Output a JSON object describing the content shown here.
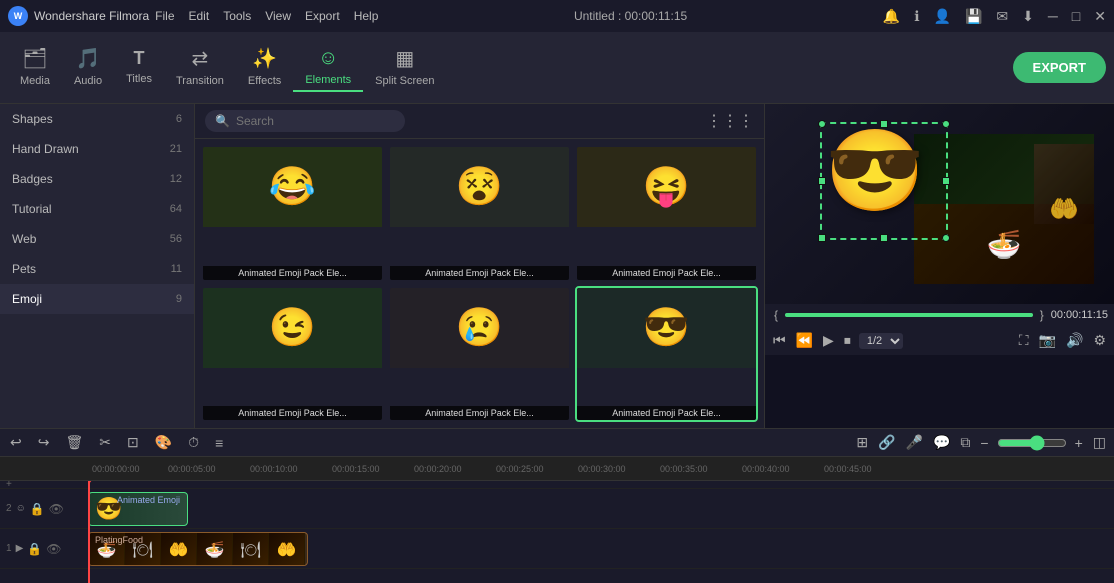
{
  "app": {
    "name": "Wondershare Filmora",
    "logo": "W",
    "title": "Untitled : 00:00:11:15"
  },
  "menu": {
    "items": [
      "File",
      "Edit",
      "Tools",
      "View",
      "Export",
      "Help"
    ]
  },
  "titlebar": {
    "controls": [
      "🔔",
      "ℹ",
      "👤",
      "💾",
      "✉",
      "⬇"
    ]
  },
  "toolbar": {
    "items": [
      {
        "id": "media",
        "label": "Media",
        "icon": "🗂"
      },
      {
        "id": "audio",
        "label": "Audio",
        "icon": "🎵"
      },
      {
        "id": "titles",
        "label": "Titles",
        "icon": "T"
      },
      {
        "id": "transition",
        "label": "Transition",
        "icon": "⇄"
      },
      {
        "id": "effects",
        "label": "Effects",
        "icon": "✨"
      },
      {
        "id": "elements",
        "label": "Elements",
        "icon": "☺"
      },
      {
        "id": "splitscreen",
        "label": "Split Screen",
        "icon": "▦"
      }
    ],
    "active": "elements",
    "export_label": "EXPORT"
  },
  "categories": [
    {
      "id": "shapes",
      "label": "Shapes",
      "count": 6
    },
    {
      "id": "handdrawn",
      "label": "Hand Drawn",
      "count": 21
    },
    {
      "id": "badges",
      "label": "Badges",
      "count": 12
    },
    {
      "id": "tutorial",
      "label": "Tutorial",
      "count": 64
    },
    {
      "id": "web",
      "label": "Web",
      "count": 56
    },
    {
      "id": "pets",
      "label": "Pets",
      "count": 11
    },
    {
      "id": "emoji",
      "label": "Emoji",
      "count": 9
    }
  ],
  "search": {
    "placeholder": "Search",
    "value": ""
  },
  "grid_items": [
    {
      "id": 1,
      "label": "Animated Emoji Pack Ele...",
      "emoji": "😂"
    },
    {
      "id": 2,
      "label": "Animated Emoji Pack Ele...",
      "emoji": "😵"
    },
    {
      "id": 3,
      "label": "Animated Emoji Pack Ele...",
      "emoji": "😝"
    },
    {
      "id": 4,
      "label": "Animated Emoji Pack Ele...",
      "emoji": "😉"
    },
    {
      "id": 5,
      "label": "Animated Emoji Pack Ele...",
      "emoji": "😢"
    },
    {
      "id": 6,
      "label": "Animated Emoji Pack Ele...",
      "emoji": "😎",
      "selected": true
    }
  ],
  "preview": {
    "time": "00:00:11:15",
    "speed": "1/2"
  },
  "timeline": {
    "ruler_marks": [
      "00:00:00:00",
      "00:00:05:00",
      "00:00:10:00",
      "00:00:15:00",
      "00:00:20:00",
      "00:00:25:00",
      "00:00:30:00",
      "00:00:35:00",
      "00:00:40:00",
      "00:00:45:00"
    ],
    "tracks": [
      {
        "id": "track1",
        "type": "emoji",
        "label": "Animated Emoji",
        "emoji": "😎",
        "track_num": "2"
      },
      {
        "id": "track2",
        "type": "video",
        "label": "PlatingFood",
        "track_num": "1"
      }
    ]
  }
}
